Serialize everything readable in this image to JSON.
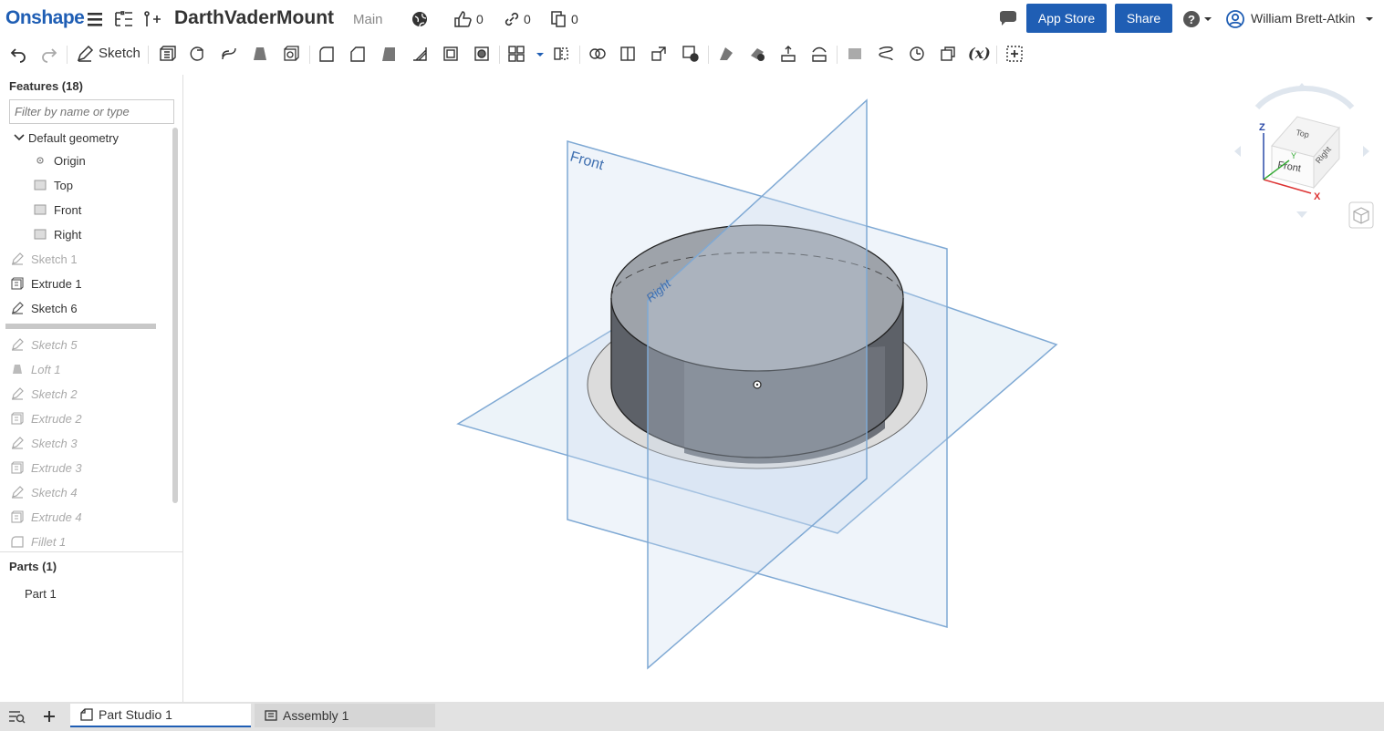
{
  "app": {
    "logo": "Onshape",
    "document_title": "DarthVaderMount",
    "branch": "Main",
    "likes": "0",
    "links": "0",
    "copies": "0",
    "app_store_label": "App Store",
    "share_label": "Share",
    "user_name": "William Brett-Atkin",
    "brand_color": "#1f5eb4"
  },
  "toolbar": {
    "sketch_label": "Sketch",
    "variable_label": "(x)"
  },
  "features": {
    "header": "Features (18)",
    "filter_placeholder": "Filter by name or type",
    "default_geometry": "Default geometry",
    "items": [
      {
        "label": "Origin"
      },
      {
        "label": "Top"
      },
      {
        "label": "Front"
      },
      {
        "label": "Right"
      },
      {
        "label": "Sketch 1"
      },
      {
        "label": "Extrude 1"
      },
      {
        "label": "Sketch 6"
      },
      {
        "label": "Sketch 5"
      },
      {
        "label": "Loft 1"
      },
      {
        "label": "Sketch 2"
      },
      {
        "label": "Extrude 2"
      },
      {
        "label": "Sketch 3"
      },
      {
        "label": "Extrude 3"
      },
      {
        "label": "Sketch 4"
      },
      {
        "label": "Extrude 4"
      },
      {
        "label": "Fillet 1"
      }
    ]
  },
  "parts": {
    "header": "Parts (1)",
    "items": [
      {
        "label": "Part 1"
      }
    ]
  },
  "viewport": {
    "plane_front": "Front",
    "plane_right": "Right",
    "cube_top": "Top",
    "cube_front": "Front",
    "cube_right": "Right",
    "axis_z": "Z",
    "axis_x": "X",
    "axis_y": "Y"
  },
  "tabs": [
    {
      "label": "Part Studio 1",
      "active": true
    },
    {
      "label": "Assembly 1",
      "active": false
    }
  ]
}
